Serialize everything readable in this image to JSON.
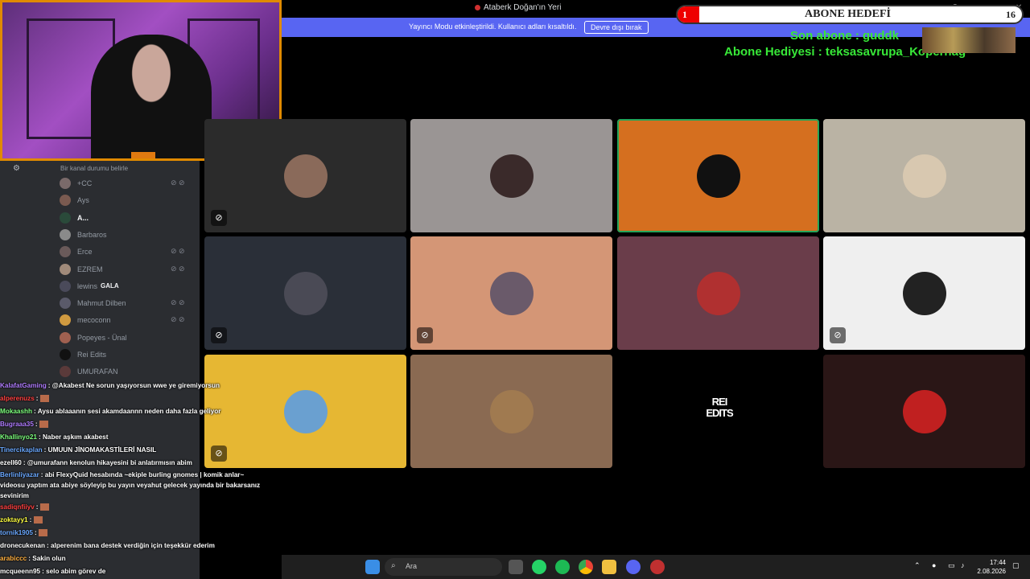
{
  "window": {
    "title": "Ataberk Doğan'ın Yeri"
  },
  "streamer_notice": {
    "text": "Yayıncı Modu etkinleştirildi. Kullanıcı adları kısaltıldı.",
    "button": "Devre dışı bırak"
  },
  "overlay": {
    "goal_label": "ABONE HEDEFİ",
    "current": "1",
    "target": "16",
    "progress": 0.0625,
    "last_sub": "Son abone : guddk",
    "gift_sub": "Abone Hediyesi : teksasavrupa_Kopernag"
  },
  "sidebar": {
    "status_placeholder": "Bir kanal durumu belirle",
    "members": [
      {
        "name": "+CC",
        "muted": true,
        "bold": false,
        "color": "#7a6a6a"
      },
      {
        "name": "Ays",
        "muted": false,
        "bold": false,
        "color": "#7a5a50"
      },
      {
        "name": "A...",
        "muted": false,
        "bold": true,
        "color": "#2a4a3a"
      },
      {
        "name": "Barbaros",
        "muted": false,
        "bold": false,
        "color": "#8a8a8a"
      },
      {
        "name": "Erce",
        "muted": true,
        "bold": false,
        "color": "#6a5a5a"
      },
      {
        "name": "EZREM",
        "muted": true,
        "bold": false,
        "color": "#a08a7a"
      },
      {
        "name": "lewins",
        "muted": false,
        "bold": false,
        "color": "#4a4a5a",
        "badge": "GALA"
      },
      {
        "name": "Mahmut Dilben",
        "muted": true,
        "bold": false,
        "color": "#5a5a6a"
      },
      {
        "name": "mecoconn",
        "muted": true,
        "bold": false,
        "color": "#d09a40"
      },
      {
        "name": "Popeyes - Ünal",
        "muted": false,
        "bold": false,
        "color": "#a06050"
      },
      {
        "name": "Rei Edits",
        "muted": false,
        "bold": false,
        "color": "#111111"
      },
      {
        "name": "UMURAFAN",
        "muted": false,
        "bold": false,
        "color": "#5a3a3a"
      }
    ]
  },
  "grid": {
    "tiles": [
      {
        "bg": "#2b2b2b",
        "avatar": "#8a6a5a",
        "mic_off": true,
        "highlight": false
      },
      {
        "bg": "#9a9594",
        "avatar": "#3a2a2a",
        "mic_off": false,
        "highlight": false
      },
      {
        "bg": "#d56f1f",
        "avatar": "#111111",
        "mic_off": false,
        "highlight": true
      },
      {
        "bg": "#bab3a4",
        "avatar": "#d8c8b0",
        "mic_off": false,
        "highlight": false
      },
      {
        "bg": "#2a2f38",
        "avatar": "#4a4a55",
        "mic_off": true,
        "highlight": false
      },
      {
        "bg": "#d49676",
        "avatar": "#6a5a6a",
        "mic_off": true,
        "highlight": false
      },
      {
        "bg": "#6a3d4a",
        "avatar": "#b03030",
        "mic_off": false,
        "highlight": false
      },
      {
        "bg": "#efefef",
        "avatar": "#222222",
        "mic_off": true,
        "highlight": false
      },
      {
        "bg": "#e6b733",
        "avatar": "#6aa0d0",
        "mic_off": true,
        "highlight": false
      },
      {
        "bg": "#8a6a52",
        "avatar": "#a07a50",
        "mic_off": false,
        "highlight": false
      },
      {
        "bg": "#000000",
        "avatar": "",
        "mic_off": false,
        "highlight": false,
        "text": "REI EDITS"
      },
      {
        "bg": "#2a1616",
        "avatar": "#c02020",
        "mic_off": false,
        "highlight": false
      }
    ]
  },
  "chat": [
    {
      "user": "KalafatGaming",
      "color": "#b07cff",
      "msg": "@Akabest Ne sorun yaşıyorsun wwe ye giremiyorsun"
    },
    {
      "user": "alperenuzs",
      "color": "#ff4040",
      "msg": ""
    },
    {
      "user": "Mokaashh",
      "color": "#7cff7c",
      "msg": "Aysu ablaaanın sesi akamdaannn neden daha fazla geliyor"
    },
    {
      "user": "Bugraaa35",
      "color": "#b07cff",
      "msg": ""
    },
    {
      "user": "Khallinyo21",
      "color": "#7cff7c",
      "msg": "Naber aşkım akabest"
    },
    {
      "user": "Tinercikaplan",
      "color": "#6aa8ff",
      "msg": "UMUUN JİNOMAKASTİLERİ NASIL"
    },
    {
      "user": "ezell60",
      "color": "#ffffff",
      "msg": "@umurafann kenolun hikayesini bi anlatırmısın abim"
    },
    {
      "user": "Berlinliyazar",
      "color": "#6aa8ff",
      "msg": "abi FlexyQuid hesabında ~ekiple burling gnomes | komik anlar~ videosu yaptım ata abiye söyleyip bu yayın veyahut gelecek yayında bir bakarsanız sevinirim",
      "wrap": true
    },
    {
      "user": "sadiqnfiiyv",
      "color": "#ff4040",
      "msg": ""
    },
    {
      "user": "zoktayy1",
      "color": "#ffff40",
      "msg": ""
    },
    {
      "user": "tornik1905",
      "color": "#6aa8ff",
      "msg": ""
    },
    {
      "user": "dronecukenan",
      "color": "#ffffff",
      "msg": "alperenim bana destek verdiğin için teşekkür ederim"
    },
    {
      "user": "arabiccc",
      "color": "#ffb040",
      "msg": "Sakin olun"
    },
    {
      "user": "mcqueenn95",
      "color": "#ffffff",
      "msg": "selo abim görev de"
    }
  ],
  "taskbar": {
    "search_label": "Ara",
    "time": "17:44",
    "date": "2.08.2026"
  }
}
